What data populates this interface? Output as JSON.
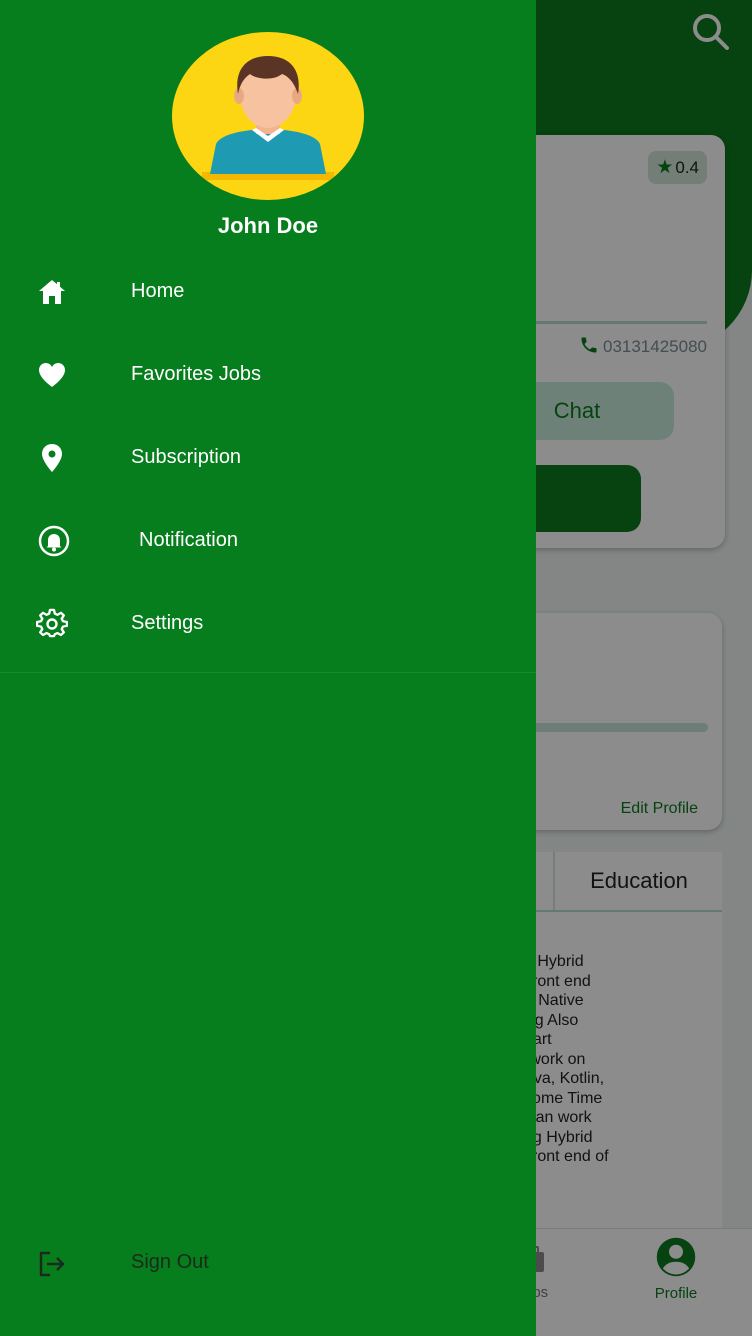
{
  "colors": {
    "primary": "#077e1e",
    "accent_light": "#c9ecdc",
    "avatar_bg": "#fcd612"
  },
  "background_screen": {
    "rating": {
      "icon": "star-icon",
      "value": "0.4"
    },
    "phone": {
      "icon": "phone-icon",
      "number": "03131425080"
    },
    "chat_button_label": "Chat",
    "edit_profile_label": "Edit Profile",
    "tabs": {
      "active_label": "Education"
    },
    "description_lines": [
      "r building Hybrid",
      "ows the front end",
      " On react Native",
      " Designing Also",
      "aScriptStart",
      "me Also work on",
      "ork on Java, Kotlin,",
      "d Apps,Some Time",
      "of web. Can work",
      "or building Hybrid",
      "ows the front end of"
    ],
    "bottom_nav": {
      "jobs_label": "obs",
      "profile_label": "Profile"
    }
  },
  "drawer": {
    "user_name": "John Doe",
    "menu_items": [
      {
        "label": "Home",
        "icon": "home-icon"
      },
      {
        "label": "Favorites Jobs",
        "icon": "heart-icon"
      },
      {
        "label": "Subscription",
        "icon": "location-pin-icon"
      },
      {
        "label": "Notification",
        "icon": "bell-icon"
      },
      {
        "label": "Settings",
        "icon": "gear-icon"
      }
    ],
    "sign_out": {
      "label": "Sign Out",
      "icon": "logout-icon"
    }
  }
}
